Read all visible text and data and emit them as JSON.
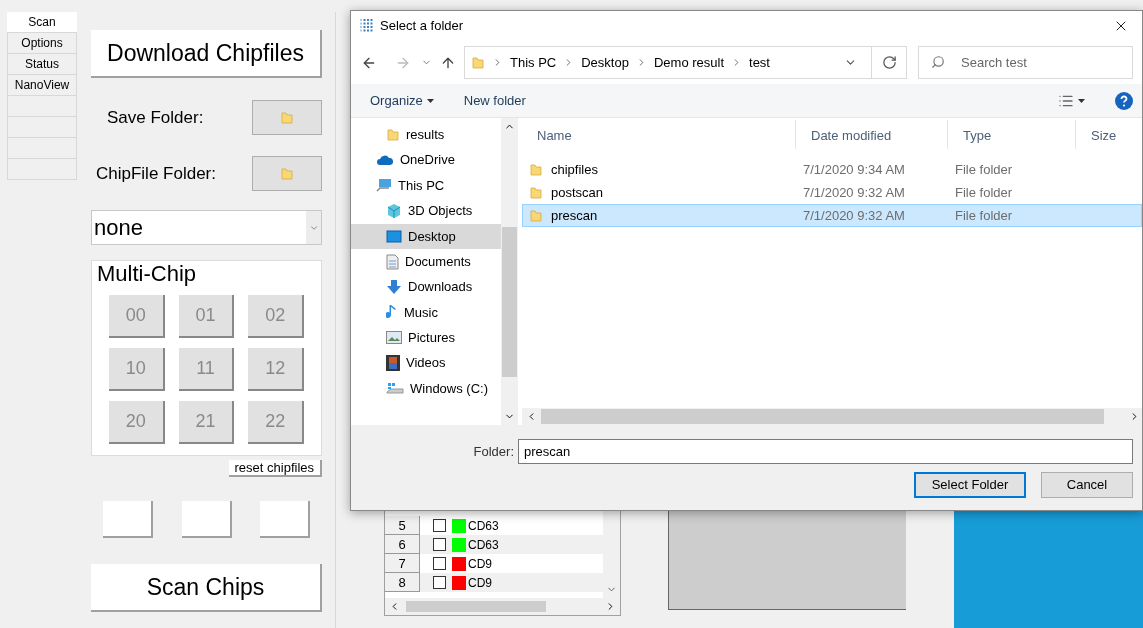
{
  "app": {
    "tabs": [
      {
        "label": "Scan",
        "selected": true
      },
      {
        "label": "Options",
        "selected": false
      },
      {
        "label": "Status",
        "selected": false
      },
      {
        "label": "NanoView",
        "selected": false
      }
    ],
    "download_button": "Download Chipfiles",
    "save_folder_label": "Save Folder:",
    "chipfile_folder_label": "ChipFile Folder:",
    "dropdown_value": "none",
    "multichip": {
      "title": "Multi-Chip",
      "chips": [
        {
          "label": "00",
          "disabled": true
        },
        {
          "label": "01",
          "disabled": true
        },
        {
          "label": "02",
          "disabled": true
        },
        {
          "label": "10",
          "disabled": true
        },
        {
          "label": "11",
          "disabled": true
        },
        {
          "label": "12",
          "disabled": true
        },
        {
          "label": "20",
          "disabled": true
        },
        {
          "label": "21",
          "disabled": true
        },
        {
          "label": "22",
          "disabled": true
        }
      ]
    },
    "reset_button": "reset chipfiles",
    "scan_button": "Scan Chips",
    "table": {
      "rows": [
        {
          "number": "5",
          "checked": false,
          "color": "#00ff00",
          "label": "CD63"
        },
        {
          "number": "6",
          "checked": false,
          "color": "#00ff00",
          "label": "CD63"
        },
        {
          "number": "7",
          "checked": false,
          "color": "#ff0000",
          "label": "CD9"
        },
        {
          "number": "8",
          "checked": false,
          "color": "#ff0000",
          "label": "CD9"
        }
      ]
    }
  },
  "dialog": {
    "title": "Select a folder",
    "breadcrumb": [
      "This PC",
      "Desktop",
      "Demo result",
      "test"
    ],
    "search": {
      "placeholder": "Search test"
    },
    "toolbar": {
      "organize": "Organize",
      "new_folder": "New folder"
    },
    "nav_items": [
      {
        "label": "results",
        "kind": "folder",
        "indented": true,
        "selected": false
      },
      {
        "label": "OneDrive",
        "kind": "cloud",
        "indented": false,
        "selected": false
      },
      {
        "label": "This PC",
        "kind": "pc",
        "indented": false,
        "selected": false
      },
      {
        "label": "3D Objects",
        "kind": "cube",
        "indented": true,
        "selected": false
      },
      {
        "label": "Desktop",
        "kind": "desktop",
        "indented": true,
        "selected": true
      },
      {
        "label": "Documents",
        "kind": "document",
        "indented": true,
        "selected": false
      },
      {
        "label": "Downloads",
        "kind": "download",
        "indented": true,
        "selected": false
      },
      {
        "label": "Music",
        "kind": "music",
        "indented": true,
        "selected": false
      },
      {
        "label": "Pictures",
        "kind": "pictures",
        "indented": true,
        "selected": false
      },
      {
        "label": "Videos",
        "kind": "videos",
        "indented": true,
        "selected": false
      },
      {
        "label": "Windows (C:)",
        "kind": "drive",
        "indented": true,
        "selected": false
      }
    ],
    "columns": [
      "Name",
      "Date modified",
      "Type",
      "Size"
    ],
    "files": [
      {
        "name": "chipfiles",
        "date": "7/1/2020 9:34 AM",
        "type": "File folder",
        "selected": false
      },
      {
        "name": "postscan",
        "date": "7/1/2020 9:32 AM",
        "type": "File folder",
        "selected": false
      },
      {
        "name": "prescan",
        "date": "7/1/2020 9:32 AM",
        "type": "File folder",
        "selected": true
      }
    ],
    "folder_label": "Folder:",
    "folder_value": "prescan",
    "buttons": [
      "Select Folder",
      "Cancel"
    ]
  }
}
